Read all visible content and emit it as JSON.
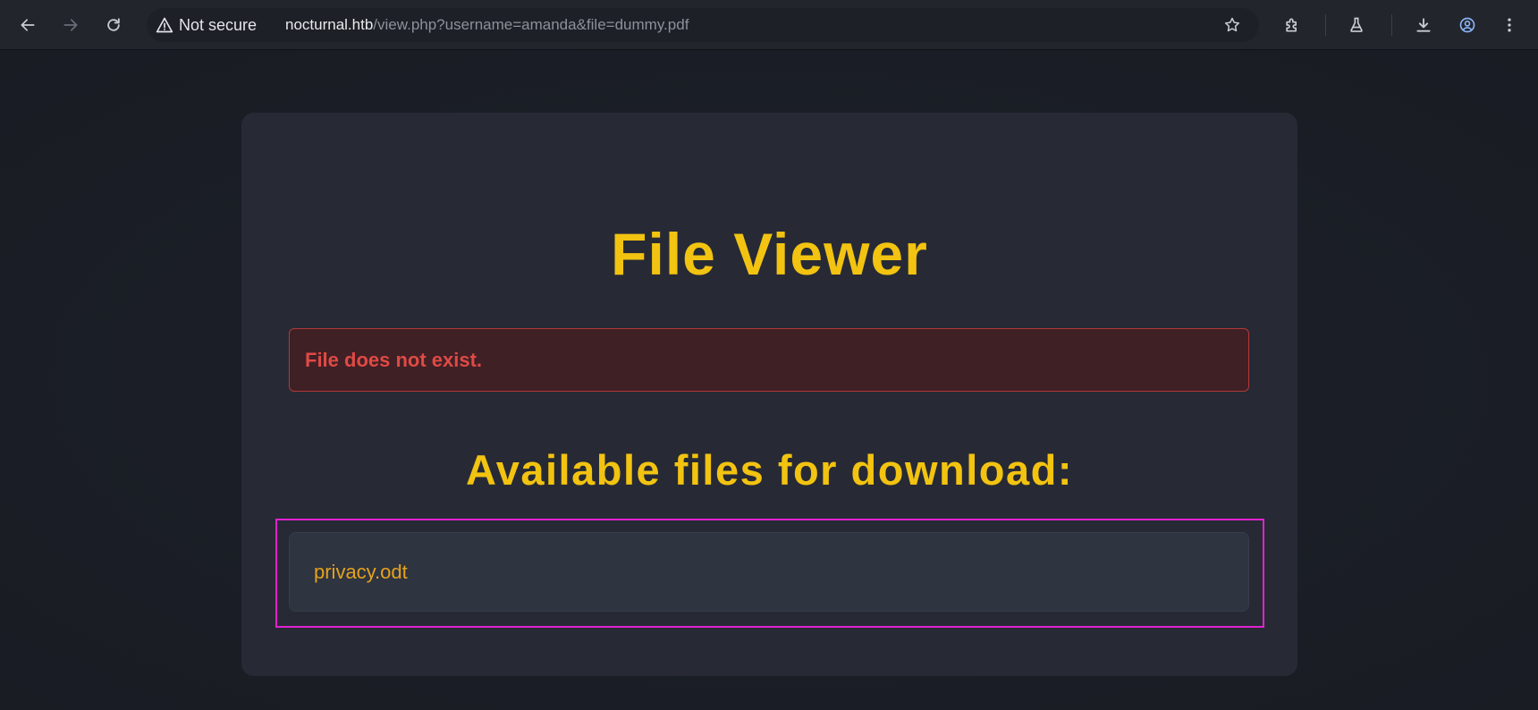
{
  "browser": {
    "security_label": "Not secure",
    "url_host": "nocturnal.htb",
    "url_path": "/view.php?username=amanda&file=dummy.pdf",
    "icons": [
      "back-icon",
      "forward-icon",
      "reload-icon",
      "warning-icon",
      "star-icon",
      "extensions-icon",
      "labs-icon",
      "download-icon",
      "profile-icon",
      "menu-icon"
    ]
  },
  "page": {
    "title": "File Viewer",
    "error_message": "File does not exist.",
    "subtitle": "Available files for download:",
    "files": [
      {
        "name": "privacy.odt"
      }
    ]
  },
  "colors": {
    "accent": "#f2c311",
    "error_text": "#e04a45",
    "error_bg": "#3f2025",
    "file_link": "#e6a21c",
    "highlight": "#e221d0"
  }
}
